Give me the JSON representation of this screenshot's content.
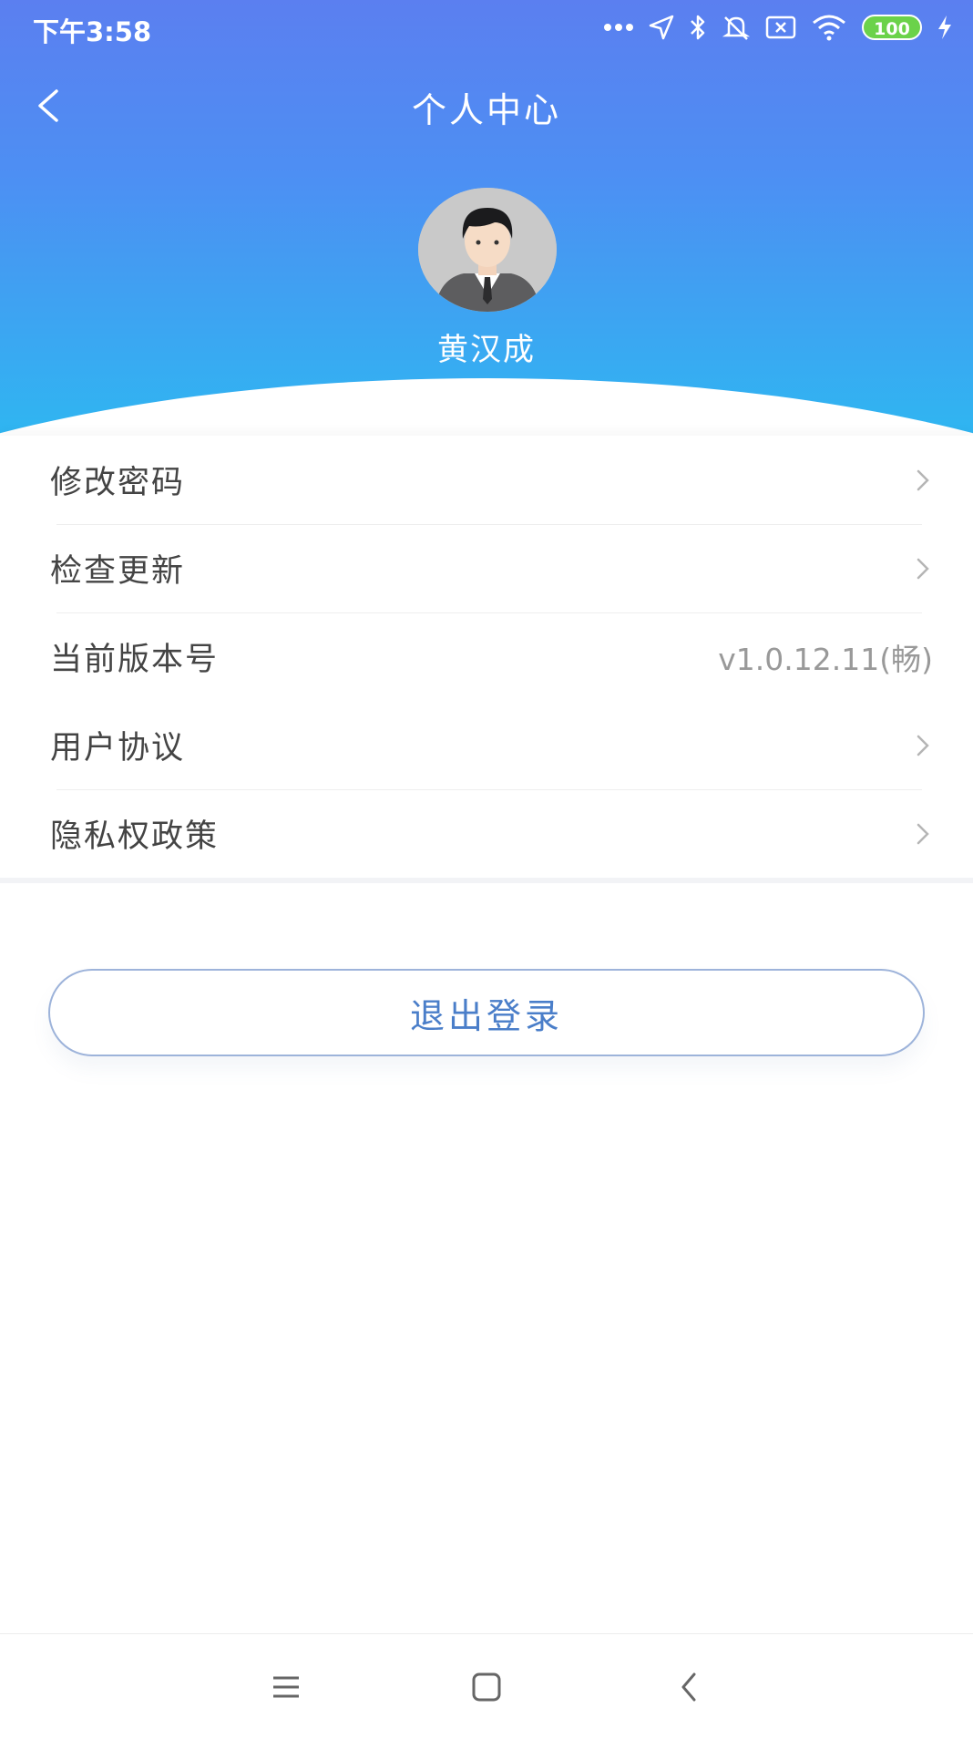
{
  "status_bar": {
    "time": "下午3:58",
    "battery": "100",
    "icons": [
      "more-dots-icon",
      "location-icon",
      "bluetooth-icon",
      "mute-icon",
      "sim-x-icon",
      "wifi-icon",
      "battery-icon",
      "charging-icon"
    ]
  },
  "header": {
    "title": "个人中心",
    "back_icon": "back-arrow-icon",
    "username": "黄汉成",
    "gradient_top": "#5b7ff0",
    "gradient_bottom": "#2fb6f1"
  },
  "menu": {
    "items": [
      {
        "label": "修改密码",
        "value": "",
        "icon": "chevron-right-icon"
      },
      {
        "label": "检查更新",
        "value": "",
        "icon": "chevron-right-icon"
      },
      {
        "label": "当前版本号",
        "value": "v1.0.12.11(畅)",
        "icon": ""
      },
      {
        "label": "用户协议",
        "value": "",
        "icon": "chevron-right-icon"
      },
      {
        "label": "隐私权政策",
        "value": "",
        "icon": "chevron-right-icon"
      }
    ]
  },
  "logout": {
    "label": "退出登录",
    "color": "#4a7ec9"
  },
  "bottom_nav": {
    "icons": [
      "menu-icon",
      "home-square-icon",
      "back-icon"
    ]
  }
}
